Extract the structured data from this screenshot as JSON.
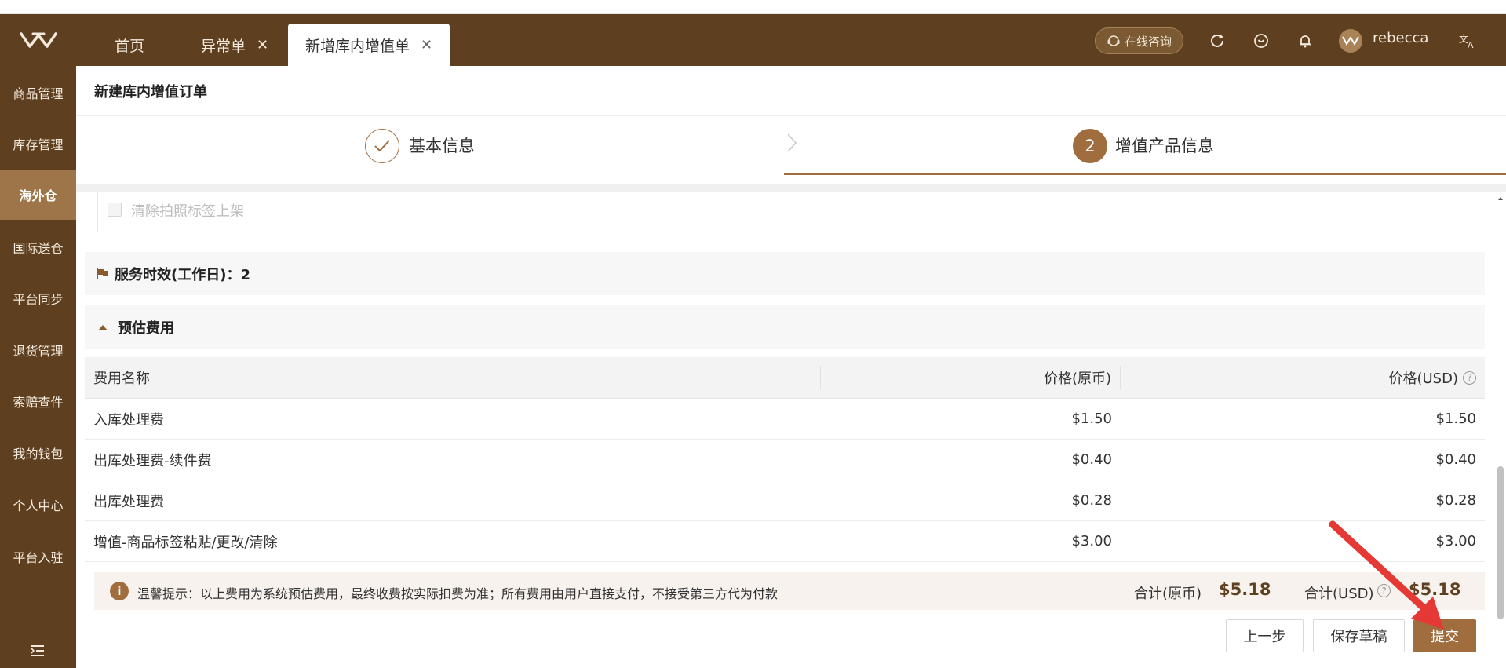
{
  "header": {
    "tabs": [
      {
        "label": "首页",
        "closable": false
      },
      {
        "label": "异常单",
        "closable": true
      },
      {
        "label": "新增库内增值单",
        "closable": true,
        "active": true
      }
    ],
    "consult_label": "在线咨询",
    "username": "rebecca",
    "icons": [
      "refresh-icon",
      "heart-icon",
      "bell-icon",
      "translate-icon"
    ]
  },
  "sidebar": {
    "items": [
      {
        "label": "商品管理"
      },
      {
        "label": "库存管理"
      },
      {
        "label": "海外仓",
        "active": true
      },
      {
        "label": "国际送仓"
      },
      {
        "label": "平台同步"
      },
      {
        "label": "退货管理"
      },
      {
        "label": "索赔查件"
      },
      {
        "label": "我的钱包"
      },
      {
        "label": "个人中心"
      },
      {
        "label": "平台入驻"
      }
    ]
  },
  "page": {
    "title": "新建库内增值订单",
    "steps": [
      {
        "index": "1",
        "label": "基本信息",
        "status": "done"
      },
      {
        "index": "2",
        "label": "增值产品信息",
        "status": "active"
      }
    ],
    "checkbox_label": "清除拍照标签上架",
    "service_time": "服务时效(工作日)：2",
    "fee_section_title": "预估费用"
  },
  "fee_table": {
    "headers": [
      "费用名称",
      "价格(原币)",
      "价格(USD)"
    ],
    "rows": [
      [
        "入库处理费",
        "$1.50",
        "$1.50"
      ],
      [
        "出库处理费-续件费",
        "$0.40",
        "$0.40"
      ],
      [
        "出库处理费",
        "$0.28",
        "$0.28"
      ],
      [
        "增值-商品标签粘贴/更改/清除",
        "$3.00",
        "$3.00"
      ]
    ]
  },
  "tip": {
    "icon": "i",
    "text": "温馨提示：以上费用为系统预估费用，最终收费按实际扣费为准；所有费用由用户直接支付，不接受第三方代为付款",
    "total_orig_label": "合计(原币)",
    "total_orig_value": "$5.18",
    "total_usd_label": "合计(USD)",
    "total_usd_value": "$5.18"
  },
  "actions": {
    "prev": "上一步",
    "save_draft": "保存草稿",
    "submit": "提交"
  },
  "colors": {
    "brand_dark": "#5e3f1f",
    "brand_accent": "#a06d3f",
    "annotation_arrow": "#e53935"
  }
}
